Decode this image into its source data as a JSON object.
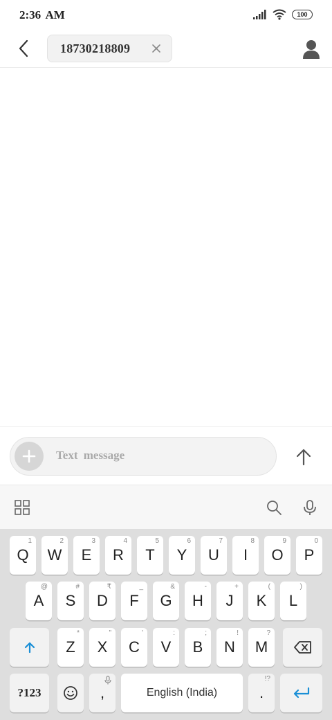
{
  "status_bar": {
    "time": "2:36  AM",
    "battery": "100"
  },
  "header": {
    "recipient": "18730218809"
  },
  "compose": {
    "placeholder": "Text  message"
  },
  "keyboard": {
    "row1": [
      {
        "label": "Q",
        "hint": "1"
      },
      {
        "label": "W",
        "hint": "2"
      },
      {
        "label": "E",
        "hint": "3"
      },
      {
        "label": "R",
        "hint": "4"
      },
      {
        "label": "T",
        "hint": "5"
      },
      {
        "label": "Y",
        "hint": "6"
      },
      {
        "label": "U",
        "hint": "7"
      },
      {
        "label": "I",
        "hint": "8"
      },
      {
        "label": "O",
        "hint": "9"
      },
      {
        "label": "P",
        "hint": "0"
      }
    ],
    "row2": [
      {
        "label": "A",
        "hint": "@"
      },
      {
        "label": "S",
        "hint": "#"
      },
      {
        "label": "D",
        "hint": "₹"
      },
      {
        "label": "F",
        "hint": "_"
      },
      {
        "label": "G",
        "hint": "&"
      },
      {
        "label": "H",
        "hint": "-"
      },
      {
        "label": "J",
        "hint": "+"
      },
      {
        "label": "K",
        "hint": "("
      },
      {
        "label": "L",
        "hint": ")"
      }
    ],
    "row3": [
      {
        "label": "Z",
        "hint": "*"
      },
      {
        "label": "X",
        "hint": "\""
      },
      {
        "label": "C",
        "hint": "'"
      },
      {
        "label": "V",
        "hint": ":"
      },
      {
        "label": "B",
        "hint": ";"
      },
      {
        "label": "N",
        "hint": "!"
      },
      {
        "label": "M",
        "hint": "?"
      }
    ],
    "symbols_key": "?123",
    "comma_key": ",",
    "space_key": "English (India)",
    "period_key": ".",
    "period_hint": "!?"
  }
}
